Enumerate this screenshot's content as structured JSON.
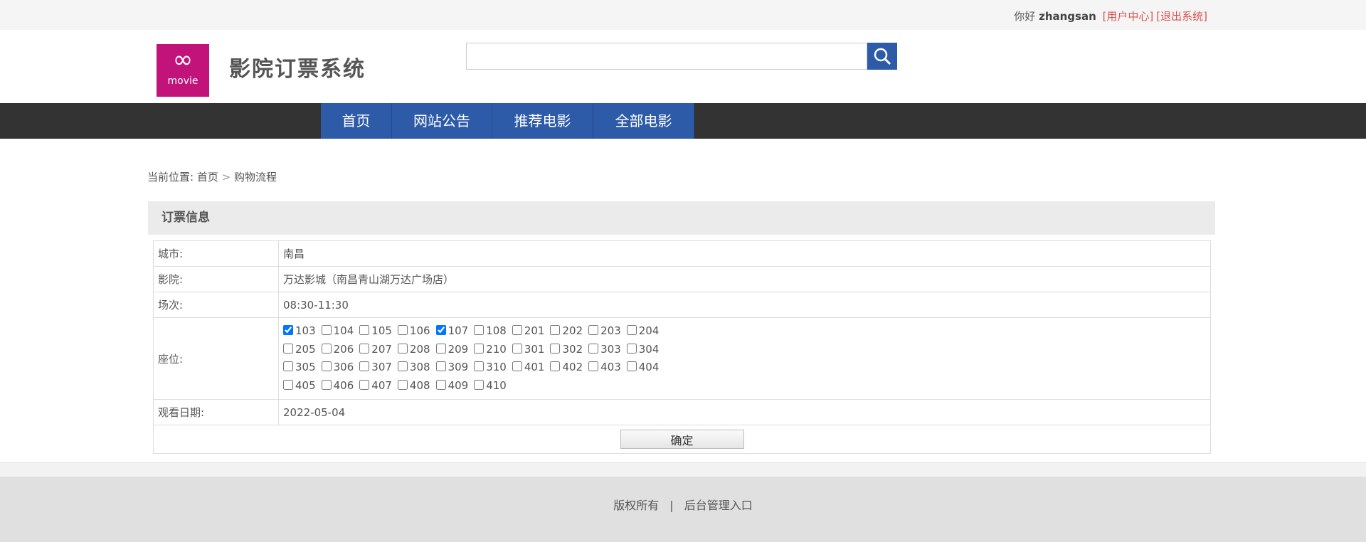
{
  "topbar": {
    "hello": "你好",
    "user": "zhangsan",
    "user_center": "[用户中心]",
    "logout": "[退出系统]"
  },
  "header": {
    "logo_text": "movie",
    "title": "影院订票系统",
    "search_placeholder": ""
  },
  "nav": [
    "首页",
    "网站公告",
    "推荐电影",
    "全部电影"
  ],
  "breadcrumb": {
    "label": "当前位置:",
    "home": "首页",
    "sep": ">",
    "current": "购物流程"
  },
  "section_title": "订票信息",
  "form": {
    "city_label": "城市:",
    "city": "南昌",
    "cinema_label": "影院:",
    "cinema": "万达影城（南昌青山湖万达广场店）",
    "session_label": "场次:",
    "session": "08:30-11:30",
    "seat_label": "座位:",
    "seats": [
      {
        "n": "103",
        "c": true
      },
      {
        "n": "104",
        "c": false
      },
      {
        "n": "105",
        "c": false
      },
      {
        "n": "106",
        "c": false
      },
      {
        "n": "107",
        "c": true
      },
      {
        "n": "108",
        "c": false
      },
      {
        "n": "201",
        "c": false
      },
      {
        "n": "202",
        "c": false
      },
      {
        "n": "203",
        "c": false
      },
      {
        "n": "204",
        "c": false
      },
      {
        "n": "205",
        "c": false
      },
      {
        "n": "206",
        "c": false
      },
      {
        "n": "207",
        "c": false
      },
      {
        "n": "208",
        "c": false
      },
      {
        "n": "209",
        "c": false
      },
      {
        "n": "210",
        "c": false
      },
      {
        "n": "301",
        "c": false
      },
      {
        "n": "302",
        "c": false
      },
      {
        "n": "303",
        "c": false
      },
      {
        "n": "304",
        "c": false
      },
      {
        "n": "305",
        "c": false
      },
      {
        "n": "306",
        "c": false
      },
      {
        "n": "307",
        "c": false
      },
      {
        "n": "308",
        "c": false
      },
      {
        "n": "309",
        "c": false
      },
      {
        "n": "310",
        "c": false
      },
      {
        "n": "401",
        "c": false
      },
      {
        "n": "402",
        "c": false
      },
      {
        "n": "403",
        "c": false
      },
      {
        "n": "404",
        "c": false
      },
      {
        "n": "405",
        "c": false
      },
      {
        "n": "406",
        "c": false
      },
      {
        "n": "407",
        "c": false
      },
      {
        "n": "408",
        "c": false
      },
      {
        "n": "409",
        "c": false
      },
      {
        "n": "410",
        "c": false
      }
    ],
    "date_label": "观看日期:",
    "date": "2022-05-04",
    "submit": "确定"
  },
  "footer": {
    "copyright": "版权所有",
    "sep": "|",
    "admin": "后台管理入口"
  }
}
